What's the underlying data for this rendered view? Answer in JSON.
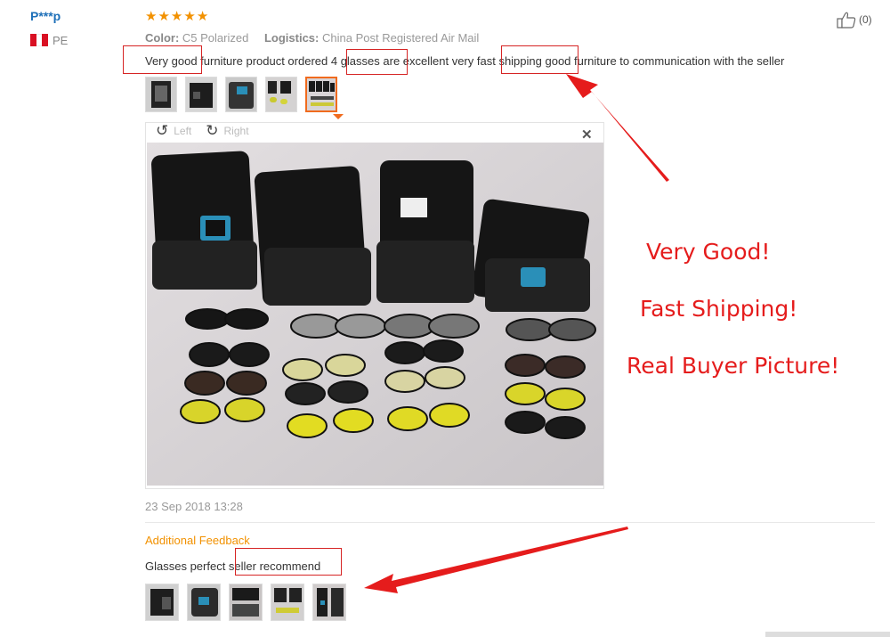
{
  "reviewer": {
    "name": "P***p",
    "country": "PE",
    "flag_colors": [
      "#d91023",
      "#ffffff",
      "#d91023"
    ]
  },
  "rating": {
    "stars": 5,
    "star_glyph": "★",
    "color": "#f29100"
  },
  "like": {
    "count": "(0)",
    "icon": "thumbs-up-icon"
  },
  "attributes": [
    {
      "label": "Color:",
      "value": "C5 Polarized"
    },
    {
      "label": "Logistics:",
      "value": "China Post Registered Air Mail"
    }
  ],
  "review_text": "Very good furniture product ordered 4 glasses are excellent very fast shipping good furniture to communication with the seller",
  "viewer": {
    "rotate_left_label": "Left",
    "rotate_right_label": "Right",
    "rotate_left_icon": "rotate-left-icon",
    "rotate_right_icon": "rotate-right-icon",
    "close_icon": "close-icon",
    "close_glyph": "✕"
  },
  "date": "23 Sep 2018 13:28",
  "additional_feedback": {
    "title": "Additional Feedback",
    "text": "Glasses perfect seller recommend"
  },
  "annotations": {
    "notes": [
      "Very Good!",
      "Fast Shipping!",
      "Real Buyer Picture!"
    ],
    "color": "#e51c1c"
  },
  "accent_color": "#f06b1e"
}
